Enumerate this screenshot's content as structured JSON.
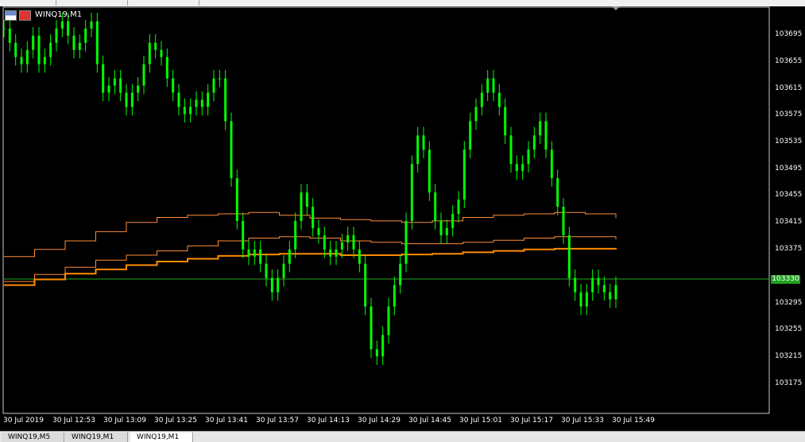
{
  "window": {
    "title": "WINQ19,M1"
  },
  "icons": [
    "chart-window-icon",
    "flag-icon"
  ],
  "colors": {
    "background": "#000000",
    "candles": "#00ff00",
    "ma_light": "#ff8c3a",
    "ma_heavy": "#ff8c00",
    "price_line": "#1fa31f"
  },
  "yaxis": {
    "labels": [
      "103695",
      "103655",
      "103615",
      "103575",
      "103535",
      "103495",
      "103455",
      "103415",
      "103375",
      "103295",
      "103255",
      "103215",
      "103175"
    ]
  },
  "xaxis": {
    "labels": [
      "30 Jul 2019",
      "30 Jul 12:53",
      "30 Jul 13:09",
      "30 Jul 13:25",
      "30 Jul 13:41",
      "30 Jul 13:57",
      "30 Jul 14:13",
      "30 Jul 14:29",
      "30 Jul 14:45",
      "30 Jul 15:01",
      "30 Jul 15:17",
      "30 Jul 15:33",
      "30 Jul 15:49"
    ]
  },
  "current_price": "103330",
  "tabs": [
    {
      "label": "WINQ19,M5",
      "active": false
    },
    {
      "label": "WINQ19,M1",
      "active": false
    },
    {
      "label": "WINQ19,M1",
      "active": true
    }
  ],
  "chart_data": {
    "type": "line",
    "ylim": [
      103150,
      103720
    ],
    "price_series": [
      103690,
      103670,
      103650,
      103640,
      103660,
      103680,
      103640,
      103650,
      103670,
      103690,
      103700,
      103680,
      103660,
      103670,
      103690,
      103700,
      103640,
      103600,
      103610,
      103620,
      103600,
      103580,
      103600,
      103610,
      103640,
      103670,
      103660,
      103650,
      103620,
      103600,
      103580,
      103570,
      103580,
      103590,
      103580,
      103600,
      103620,
      103620,
      103560,
      103480,
      103420,
      103380,
      103370,
      103380,
      103360,
      103340,
      103320,
      103340,
      103360,
      103380,
      103420,
      103460,
      103440,
      103410,
      103400,
      103380,
      103370,
      103380,
      103390,
      103400,
      103380,
      103360,
      103300,
      103240,
      103230,
      103260,
      103300,
      103330,
      103360,
      103420,
      103500,
      103540,
      103520,
      103460,
      103420,
      103400,
      103410,
      103430,
      103450,
      103520,
      103560,
      103580,
      103600,
      103620,
      103600,
      103580,
      103540,
      103500,
      103490,
      103500,
      103520,
      103540,
      103560,
      103520,
      103480,
      103440,
      103400,
      103340,
      103320,
      103300,
      103320,
      103340,
      103330,
      103320,
      103310,
      103330
    ],
    "ma_series": [
      {
        "values": [
          103370,
          103380,
          103392,
          103405,
          103418,
          103425,
          103428,
          103430,
          103432,
          103428,
          103424,
          103422,
          103420,
          103418,
          103420,
          103425,
          103428,
          103430,
          103432,
          103430,
          103424
        ]
      },
      {
        "values": [
          103335,
          103345,
          103355,
          103365,
          103372,
          103378,
          103385,
          103392,
          103396,
          103398,
          103396,
          103392,
          103390,
          103388,
          103388,
          103390,
          103393,
          103396,
          103398,
          103398,
          103394
        ]
      },
      {
        "values": [
          103330,
          103338,
          103346,
          103352,
          103358,
          103363,
          103367,
          103371,
          103373,
          103374,
          103374,
          103372,
          103372,
          103373,
          103374,
          103376,
          103378,
          103380,
          103381,
          103381,
          103380
        ]
      }
    ]
  }
}
